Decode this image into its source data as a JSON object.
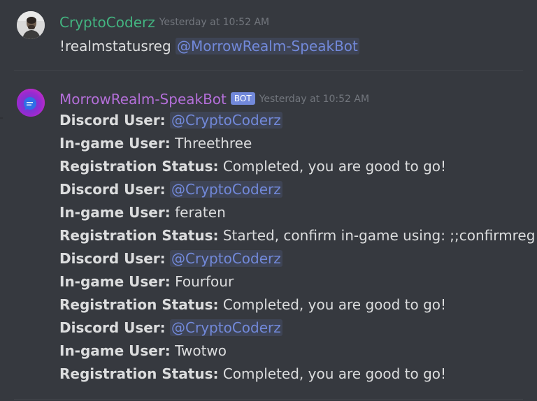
{
  "messages": [
    {
      "username": "CryptoCoderz",
      "timestamp": "Yesterday at 10:52 AM",
      "text": "!realmstatusreg",
      "mention": "@MorrowRealm-SpeakBot",
      "avatar_icon": "user-avatar"
    },
    {
      "username": "MorrowRealm-SpeakBot",
      "tag": "BOT",
      "timestamp": "Yesterday at 10:52 AM",
      "avatar_icon": "bot-chat-avatar",
      "lines": [
        {
          "label": "Discord User:",
          "mention": "@CryptoCoderz"
        },
        {
          "label": "In-game User:",
          "value": "Threethree"
        },
        {
          "label": "Registration Status:",
          "value": "Completed, you are good to go!"
        },
        {
          "label": "Discord User:",
          "mention": "@CryptoCoderz"
        },
        {
          "label": "In-game User:",
          "value": "feraten"
        },
        {
          "label": "Registration Status:",
          "value": "Started, confirm in-game using: ;;confirmreg"
        },
        {
          "label": "Discord User:",
          "mention": "@CryptoCoderz"
        },
        {
          "label": "In-game User:",
          "value": "Fourfour"
        },
        {
          "label": "Registration Status:",
          "value": "Completed, you are good to go!"
        },
        {
          "label": "Discord User:",
          "mention": "@CryptoCoderz"
        },
        {
          "label": "In-game User:",
          "value": "Twotwo"
        },
        {
          "label": "Registration Status:",
          "value": "Completed, you are good to go!"
        }
      ]
    }
  ],
  "colors": {
    "background": "#36393f",
    "human_username": "#43b581",
    "bot_username": "#b46fd9",
    "mention": "#7289da",
    "bot_tag": "#7289da",
    "timestamp": "#72767d",
    "text": "#dcddde"
  }
}
